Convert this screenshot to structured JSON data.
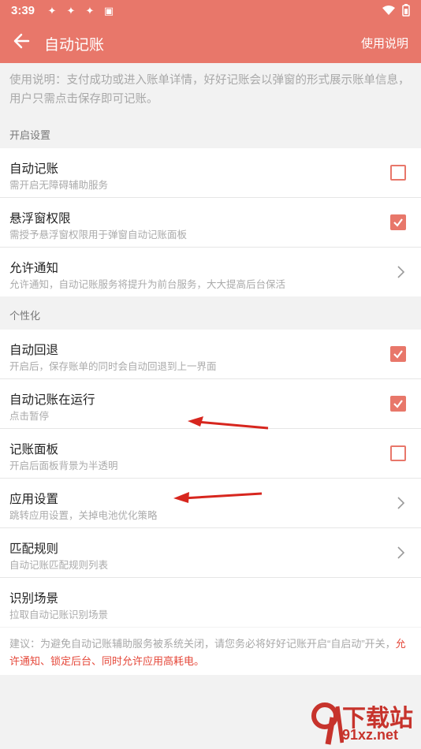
{
  "status": {
    "time": "3:39"
  },
  "header": {
    "title": "自动记账",
    "help": "使用说明"
  },
  "intro": "使用说明：支付成功或进入账单详情，好好记账会以弹窗的形式展示账单信息，用户只需点击保存即可记账。",
  "sections": {
    "open": "开启设置",
    "personal": "个性化"
  },
  "open_items": [
    {
      "title": "自动记账",
      "subtitle": "需开启无障碍辅助服务"
    },
    {
      "title": "悬浮窗权限",
      "subtitle": "需授予悬浮窗权限用于弹窗自动记账面板"
    },
    {
      "title": "允许通知",
      "subtitle": "允许通知，自动记账服务将提升为前台服务，大大提高后台保活"
    }
  ],
  "personal_items": [
    {
      "title": "自动回退",
      "subtitle": "开启后，保存账单的同时会自动回退到上一界面"
    },
    {
      "title": "自动记账在运行",
      "subtitle": "点击暂停"
    },
    {
      "title": "记账面板",
      "subtitle": "开启后面板背景为半透明"
    },
    {
      "title": "应用设置",
      "subtitle": "跳转应用设置，关掉电池优化策略"
    },
    {
      "title": "匹配规则",
      "subtitle": "自动记账匹配规则列表"
    },
    {
      "title": "识别场景",
      "subtitle": "拉取自动记账识别场景"
    }
  ],
  "advice": {
    "part1": "建议：为避免自动记账辅助服务被系统关闭，请您务必将好好记账开启“自启动”开关，",
    "part2": "允许通知、锁定后台、同时允许应用高耗电。"
  },
  "watermark": {
    "big": "下载站",
    "small": "91xz.net"
  },
  "colors": {
    "accent": "#e8776a",
    "warning": "#e5483a"
  }
}
